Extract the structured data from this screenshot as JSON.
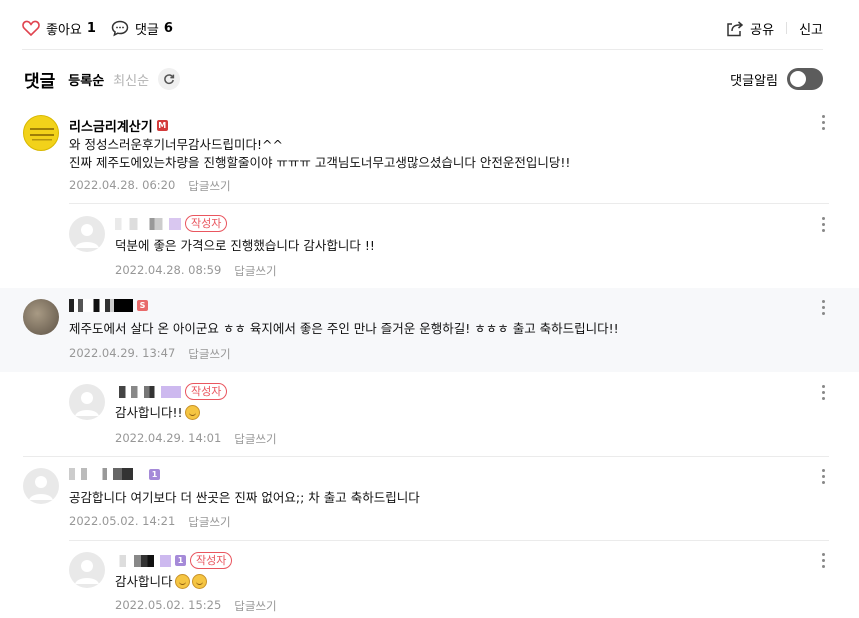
{
  "topbar": {
    "like_label": "좋아요",
    "like_count": "1",
    "comment_label": "댓글",
    "comment_count": "6",
    "share_label": "공유",
    "report_label": "신고"
  },
  "sortbar": {
    "title": "댓글",
    "sort_registered": "등록순",
    "sort_latest": "최신순",
    "alarm_label": "댓글알림"
  },
  "reply_label": "답글쓰기",
  "author_badge": "작성자",
  "comments": [
    {
      "name": "리스금리계산기",
      "avatar_text": "리스연체\n파헤치기",
      "body_line1": "와 정성스러운후기너무감사드립미다!^^",
      "body_line2": "진짜 제주도에있는차량을 진행할줄이야 ㅠㅠㅠ 고객님도너무고생많으셨습니다 안전운전입니당!!",
      "date": "2022.04.28. 06:20"
    },
    {
      "body_line1": "덕분에 좋은 가격으로 진행했습니다 감사합니다 !!",
      "date": "2022.04.28. 08:59"
    },
    {
      "body_line1": "제주도에서 살다 온 아이군요 ㅎㅎ 육지에서 좋은 주인 만나 즐거운 운행하길! ㅎㅎㅎ 출고 축하드립니다!!",
      "date": "2022.04.29. 13:47"
    },
    {
      "body_line1": "감사합니다!!",
      "date": "2022.04.29. 14:01"
    },
    {
      "body_line1": "공감합니다 여기보다 더 싼곳은 진짜 없어요;; 차 출고 축하드립니다",
      "date": "2022.05.02. 14:21"
    },
    {
      "body_line1": "감사합니다",
      "date": "2022.05.02. 15:25"
    }
  ]
}
